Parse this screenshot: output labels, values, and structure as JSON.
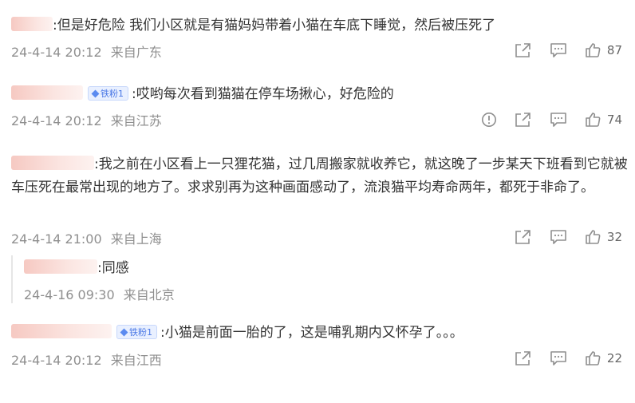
{
  "comments": [
    {
      "text": ":但是好危险 我们小区就是有猫妈妈带着小猫在车底下睡觉，然后被压死了",
      "time": "24-4-14 20:12",
      "location": "来自广东",
      "likes": "87"
    },
    {
      "badge": "铁粉1",
      "text": ":哎哟每次看到猫猫在停车场揪心，好危险的",
      "time": "24-4-14 20:12",
      "location": "来自江苏",
      "likes": "74"
    },
    {
      "text": ":我之前在小区看上一只狸花猫，过几周搬家就收养它，就这晚了一步某天下班看到它就被车压死在最常出现的地方了。求求别再为这种画面感动了，流浪猫平均寿命两年，都死于非命了。",
      "time": "24-4-14 21:00",
      "location": "来自上海",
      "likes": "32"
    },
    {
      "badge": "铁粉1",
      "text": ":小猫是前面一胎的了，这是哺乳期内又怀孕了。。。",
      "time": "24-4-14 20:12",
      "location": "来自江西",
      "likes": "22"
    }
  ],
  "reply": {
    "text": ":同感",
    "time": "24-4-16 09:30",
    "location": "来自北京"
  },
  "icons": {
    "report": "report-icon",
    "share": "share-icon",
    "comment": "comment-icon",
    "like": "thumbs-up-icon"
  },
  "colors": {
    "text": "#333333",
    "meta": "#8f8f8f",
    "badge_bg": "#e9f0ff",
    "badge_text": "#4a78e6"
  }
}
